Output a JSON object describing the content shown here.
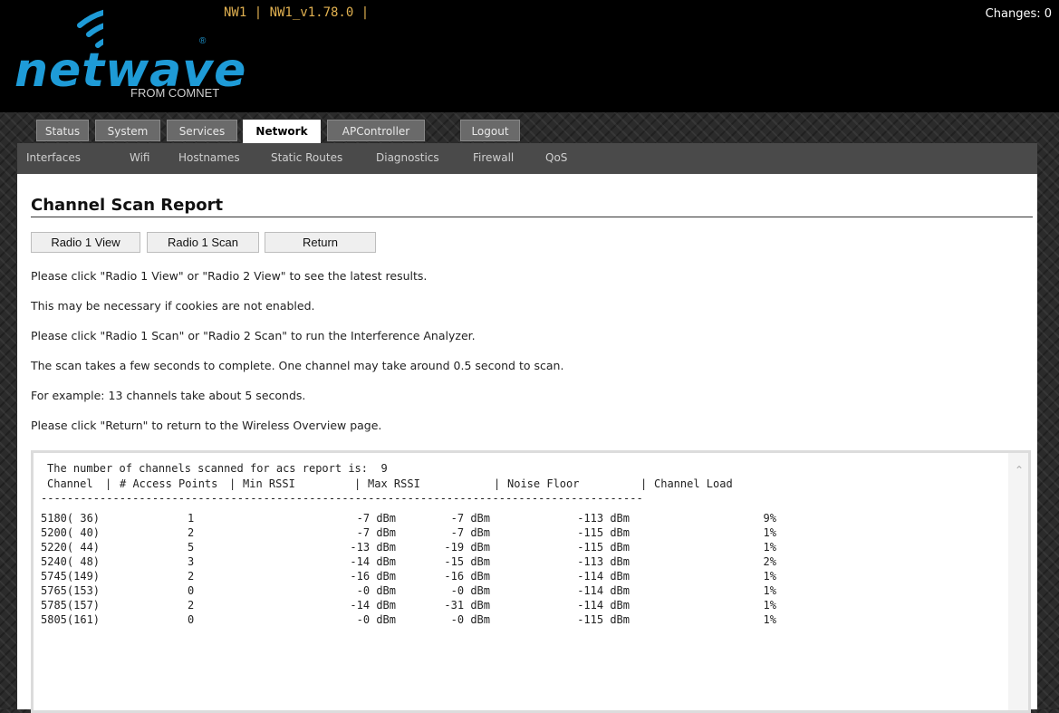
{
  "header": {
    "logo_text": "netwave",
    "logo_sub": "FROM COMNET",
    "logo_reg": "®",
    "host": "NW1 | NW1_v1.78.0 |",
    "changes": "Changes: 0"
  },
  "tabs": [
    {
      "label": "Status"
    },
    {
      "label": "System"
    },
    {
      "label": "Services"
    },
    {
      "label": "Network"
    },
    {
      "label": "APController"
    },
    {
      "label": "Logout"
    }
  ],
  "subnav": [
    {
      "label": "Interfaces"
    },
    {
      "label": "Wifi"
    },
    {
      "label": "Hostnames"
    },
    {
      "label": "Static Routes"
    },
    {
      "label": "Diagnostics"
    },
    {
      "label": "Firewall"
    },
    {
      "label": "QoS"
    }
  ],
  "page": {
    "title": "Channel Scan Report",
    "buttons": {
      "radio1_view": "Radio 1 View",
      "radio1_scan": "Radio 1 Scan",
      "return": "Return"
    },
    "paragraphs": [
      "Please click \"Radio 1 View\" or \"Radio 2 View\" to see the latest results.",
      "This may be necessary if cookies are not enabled.",
      "Please click \"Radio 1 Scan\" or \"Radio 2 Scan\" to run the Interference Analyzer.",
      "The scan takes a few seconds to complete. One channel may take around 0.5 second to scan.",
      "For example: 13 channels take about 5 seconds.",
      "Please click \"Return\" to return to the Wireless Overview page."
    ]
  },
  "report": {
    "summary": "The number of channels scanned for acs report is:  9",
    "headers": {
      "channel": "Channel",
      "aps": "# Access Points",
      "min_rssi": "Min RSSI",
      "max_rssi": "Max RSSI",
      "noise": "Noise Floor",
      "load": "Channel Load"
    },
    "separator": "--------------------------------------------------------------------------------------------",
    "rows": [
      {
        "channel": "5180( 36)",
        "aps": "1",
        "min_rssi": "-7 dBm",
        "max_rssi": "-7 dBm",
        "noise": "-113 dBm",
        "load": "9%"
      },
      {
        "channel": "5200( 40)",
        "aps": "2",
        "min_rssi": "-7 dBm",
        "max_rssi": "-7 dBm",
        "noise": "-115 dBm",
        "load": "1%"
      },
      {
        "channel": "5220( 44)",
        "aps": "5",
        "min_rssi": "-13 dBm",
        "max_rssi": "-19 dBm",
        "noise": "-115 dBm",
        "load": "1%"
      },
      {
        "channel": "5240( 48)",
        "aps": "3",
        "min_rssi": "-14 dBm",
        "max_rssi": "-15 dBm",
        "noise": "-113 dBm",
        "load": "2%"
      },
      {
        "channel": "5745(149)",
        "aps": "2",
        "min_rssi": "-16 dBm",
        "max_rssi": "-16 dBm",
        "noise": "-114 dBm",
        "load": "1%"
      },
      {
        "channel": "5765(153)",
        "aps": "0",
        "min_rssi": "-0 dBm",
        "max_rssi": "-0 dBm",
        "noise": "-114 dBm",
        "load": "1%"
      },
      {
        "channel": "5785(157)",
        "aps": "2",
        "min_rssi": "-14 dBm",
        "max_rssi": "-31 dBm",
        "noise": "-114 dBm",
        "load": "1%"
      },
      {
        "channel": "5805(161)",
        "aps": "0",
        "min_rssi": "-0 dBm",
        "max_rssi": "-0 dBm",
        "noise": "-115 dBm",
        "load": "1%"
      }
    ]
  }
}
